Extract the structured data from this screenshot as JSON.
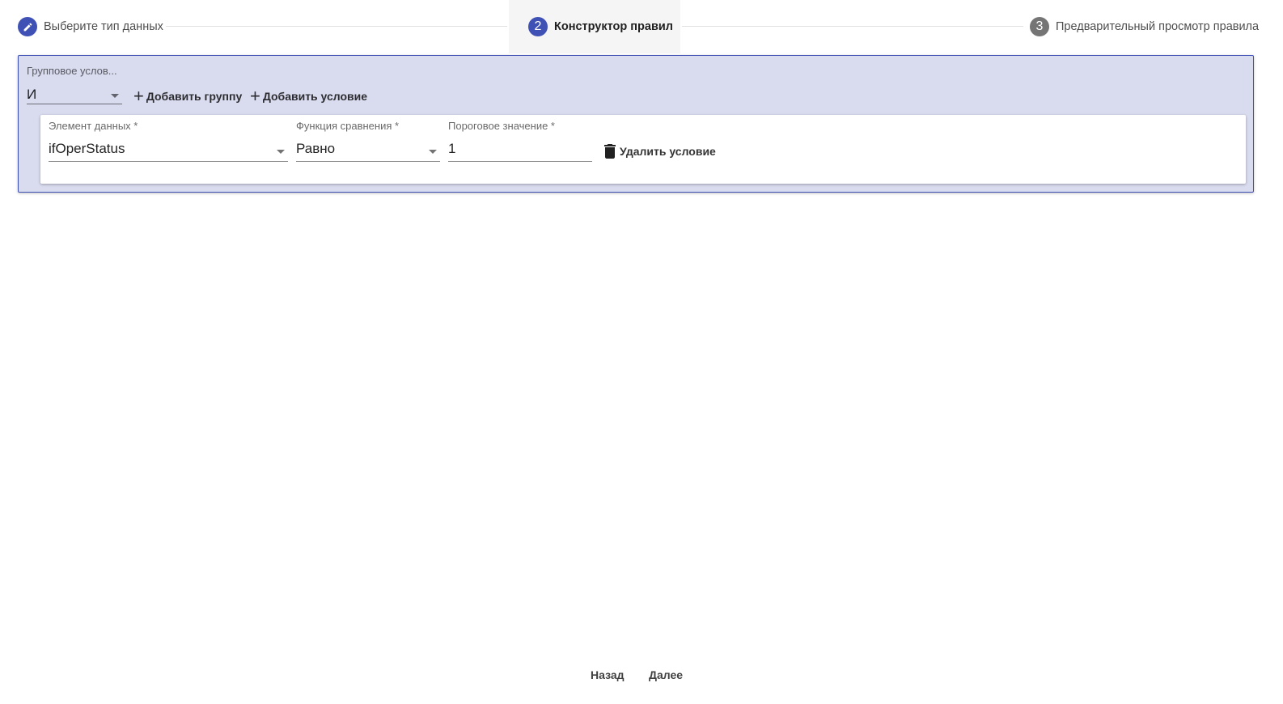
{
  "stepper": {
    "steps": [
      {
        "label": "Выберите тип данных",
        "icon": "pencil-icon",
        "state": "done"
      },
      {
        "label": "Конструктор правил",
        "number": "2",
        "state": "active"
      },
      {
        "label": "Предварительный просмотр правила",
        "number": "3",
        "state": "pending"
      }
    ]
  },
  "group": {
    "label": "Групповое услов...",
    "operator": "И",
    "add_group_label": "Добавить группу",
    "add_condition_label": "Добавить условие",
    "condition": {
      "data_element_label": "Элемент данных *",
      "data_element_value": "ifOperStatus",
      "compare_label": "Функция сравнения *",
      "compare_value": "Равно",
      "threshold_label": "Пороговое значение *",
      "threshold_value": "1",
      "delete_label": "Удалить условие"
    }
  },
  "footer": {
    "back_label": "Назад",
    "next_label": "Далее"
  },
  "colors": {
    "primary": "#3f51b5",
    "group_bg": "#d9dbef",
    "inactive_step": "#757575"
  }
}
